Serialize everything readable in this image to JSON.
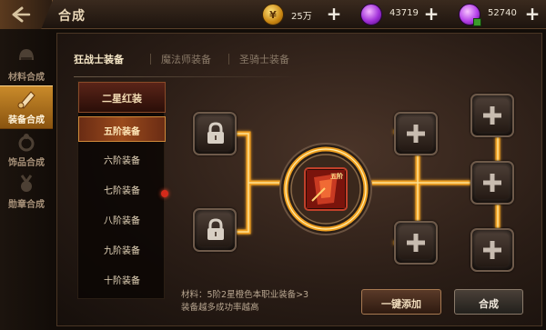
{
  "window": {
    "title": "合成"
  },
  "currencies": [
    {
      "name": "gold",
      "value": "25万",
      "icon": "gold-coin-icon",
      "color": "#e0a020"
    },
    {
      "name": "diamond",
      "value": "43719",
      "icon": "purple-gem-icon",
      "color": "#b040e0"
    },
    {
      "name": "bound-diamond",
      "value": "52740",
      "icon": "purple-gem-bound-icon",
      "color": "#c050f0"
    }
  ],
  "sidebar": {
    "items": [
      {
        "label": "材料合成",
        "icon": "helmet-icon",
        "active": false
      },
      {
        "label": "装备合成",
        "icon": "scroll-icon",
        "active": true
      },
      {
        "label": "饰品合成",
        "icon": "ring-icon",
        "active": false
      },
      {
        "label": "勋章合成",
        "icon": "medal-icon",
        "active": false
      }
    ]
  },
  "class_tabs": [
    {
      "label": "狂战士装备",
      "active": true
    },
    {
      "label": "魔法师装备",
      "active": false
    },
    {
      "label": "圣骑士装备",
      "active": false
    }
  ],
  "tier_list": {
    "header": "二星红装",
    "items": [
      "五阶装备",
      "六阶装备",
      "七阶装备",
      "八阶装备",
      "九阶装备",
      "十阶装备"
    ],
    "selected_index": 0
  },
  "synthesis": {
    "inputs": [
      {
        "state": "locked",
        "icon": "lock-icon"
      },
      {
        "state": "locked",
        "icon": "lock-icon"
      }
    ],
    "result": {
      "icon": "red-armor-icon",
      "badge": "五阶"
    },
    "extras": [
      {
        "state": "empty",
        "icon": "plus-icon"
      },
      {
        "state": "empty",
        "icon": "plus-icon"
      },
      {
        "state": "empty",
        "icon": "plus-icon"
      },
      {
        "state": "empty",
        "icon": "plus-icon"
      },
      {
        "state": "empty",
        "icon": "plus-icon"
      }
    ],
    "line_color": "#f0a020"
  },
  "footer": {
    "materials_line1": "材料：5阶2星橙色本职业装备>3",
    "materials_line2": "装备越多成功率越高",
    "add_all_label": "一键添加",
    "merge_label": "合成"
  }
}
